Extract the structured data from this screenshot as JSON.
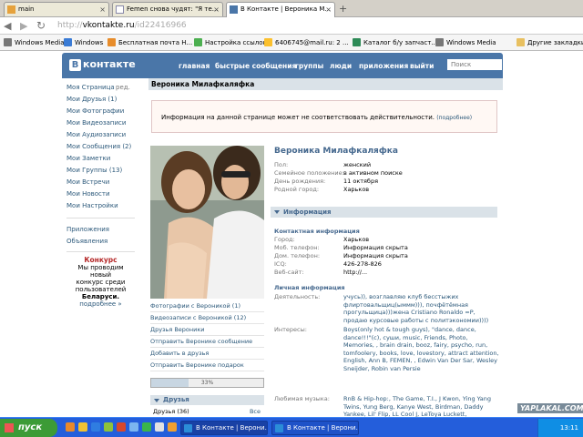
{
  "browser": {
    "tabs": [
      {
        "label": "main",
        "icon": "mail-icon"
      },
      {
        "label": "Femen снова чудят: \"Я те...",
        "icon": "page-icon"
      },
      {
        "label": "В Контакте | Вероника М...",
        "icon": "vk-icon"
      }
    ],
    "url_prefix": "http://",
    "url_host": "vkontakte.ru",
    "url_path": "/id22416966",
    "bookmarks": [
      "Windows Media",
      "Windows",
      "Бесплатная почта Н...",
      "Настройка ссылок",
      "6406745@mail.ru: 2 ...",
      "Каталог б/у запчаст...",
      "Windows Media",
      "Другие закладки"
    ]
  },
  "vk": {
    "logo": "контакте",
    "logo_mark": "В",
    "nav": [
      "главная",
      "быстрые сообщения",
      "группы",
      "люди",
      "приложения",
      "выйти"
    ],
    "search_placeholder": "Поиск",
    "left_menu": [
      "Моя Страница",
      "Мои Друзья (1)",
      "Мои Фотографии",
      "Мои Видеозаписи",
      "Мои Аудиозаписи",
      "Мои Сообщения (2)",
      "Мои Заметки",
      "Мои Группы (13)",
      "Мои Встречи",
      "Мои Новости",
      "Мои Настройки"
    ],
    "edit_label": "ред.",
    "left_extra": [
      "Приложения",
      "Объявления"
    ],
    "contest": {
      "title": "Конкурс",
      "text1": "Мы проводим новый",
      "text2": "конкурс среди",
      "text3": "пользователей",
      "text4": "Беларуси.",
      "more": "подробнее »"
    }
  },
  "profile": {
    "page_title": "Вероника Милафкаляфка",
    "notice": "Информация на данной странице может не соответствовать действительности.",
    "notice_more": "(подробнее)",
    "name": "Вероника Милафкаляфка",
    "basic": [
      {
        "k": "Пол:",
        "v": "женский"
      },
      {
        "k": "Семейное положение:",
        "v": "в активном поиске"
      },
      {
        "k": "День рождения:",
        "v": "11 октября"
      },
      {
        "k": "Родной город:",
        "v": "Харьков"
      }
    ],
    "photo_links": [
      "Фотографии с Вероникой (1)",
      "Видеозаписи с Вероникой (12)",
      "Друзья Вероники",
      "Отправить Веронике сообщение",
      "Добавить в друзья",
      "Отправить Веронике подарок"
    ],
    "progress_label": "33%",
    "progress": 0.33,
    "friends_header": "Друзья",
    "friends_count": "Друзья (36)",
    "friends_all": "Все",
    "info_header": "Информация",
    "contact_header": "Контактная информация",
    "contact": [
      {
        "k": "Город:",
        "v": "Харьков"
      },
      {
        "k": "Моб. телефон:",
        "v": "Информация скрыта"
      },
      {
        "k": "Дом. телефон:",
        "v": "Информация скрыта"
      },
      {
        "k": "ICQ:",
        "v": "426-278-826"
      },
      {
        "k": "Веб-сайт:",
        "v": "http://..."
      }
    ],
    "personal_header": "Личная информация",
    "activities_k": "Деятельность:",
    "activities_v": "учусь)), возглавляю клуб бесстыжих флиртовальщиц(ыммм))), почфётёмная прогульщица)))жена Cristiano Ronaldo =P, продаю курсовые работы с политэкономии))))",
    "interests_k": "Интересы:",
    "interests_v": "Boys(only hot & tough guys), \"dance, dance, dance!!!\"(с), суши, music, Friends, Photo, Memories, , brain drain, booz, fairy, psycho, run, tomfoolery, books, love, lovestory, attract attention, English, Ann B, FEMEN, , Edwin Van Der Sar, Wesley Sneijder, Robin van Persie",
    "music_k": "Любимая музыка:",
    "music_v": "RnB & Hip-hop:, The Game, T.I., J Kwon, Ying Yang Twins, Yung Berg, Kanye West, Birdman, Daddy Yankee, Lil' Flip, LL Cool J, LeToya Luckett, Timbaland, Missy Elliot, Ciara, Chamillionaire, Fat Joe, Chingy, Akon, Snoop Dogg, Busta Rhymes, R. Kelly, Jay-Z, 50, Lyfe Jennings, Ray J, Keri Hilson, Jay Sean, Alicia"
  },
  "taskbar": {
    "start": "пуск",
    "window": "В Контакте | Верони...",
    "window2": "В Контакте | Верони...",
    "clock": "13:11",
    "watermark": "YAPLAKAL.COM"
  }
}
